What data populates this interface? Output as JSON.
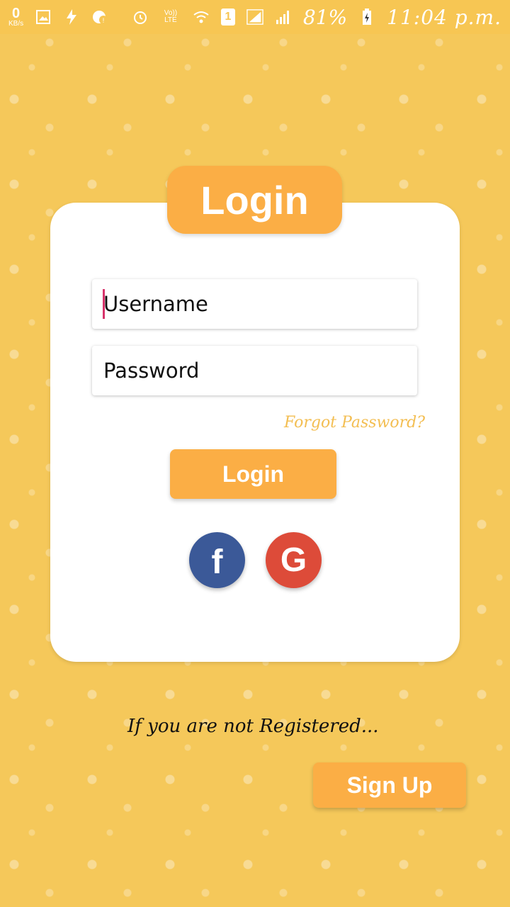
{
  "status_bar": {
    "net_speed_value": "0",
    "net_speed_unit": "KB/s",
    "network_label": "Vo)) LTE",
    "sim_slot": "1",
    "battery_percent": "81%",
    "time": "11:04 p.m.",
    "icons": [
      "image-icon",
      "charge-icon",
      "notification-icon",
      "alarm-icon",
      "volte-icon",
      "wifi-icon",
      "sim-icon",
      "signal-icon",
      "battery-icon"
    ]
  },
  "login": {
    "title": "Login",
    "username_placeholder": "Username",
    "password_placeholder": "Password",
    "forgot_password": "Forgot Password?",
    "button_label": "Login"
  },
  "social": {
    "facebook_glyph": "f",
    "google_glyph": "G"
  },
  "register": {
    "prompt": "If you are not Registered...",
    "signup_label": "Sign Up"
  },
  "colors": {
    "background": "#f5c85a",
    "accent": "#fbae45",
    "facebook": "#3b5998",
    "google": "#dd4b39",
    "caret": "#d8336b"
  }
}
